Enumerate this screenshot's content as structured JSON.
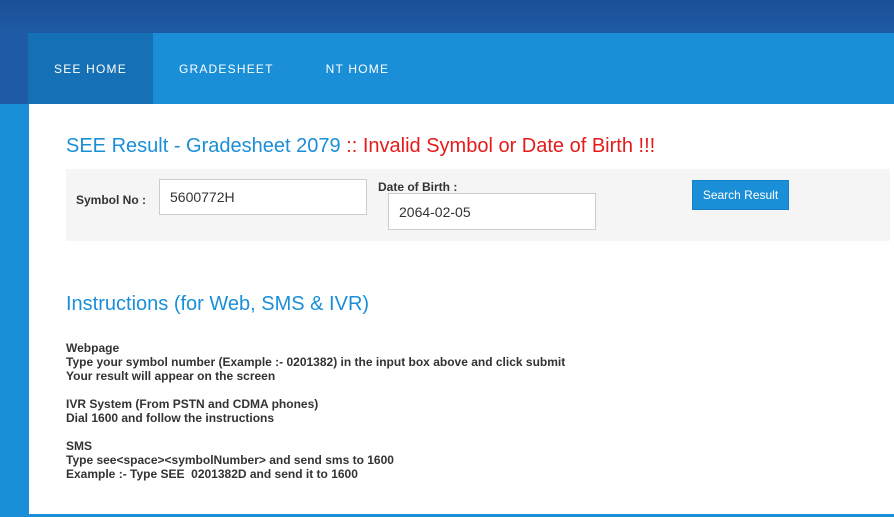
{
  "nav": {
    "items": [
      {
        "label": "SEE HOME"
      },
      {
        "label": "GRADESHEET"
      },
      {
        "label": "NT HOME"
      }
    ]
  },
  "title": {
    "main": "SEE Result - Gradesheet 2079",
    "error": " :: Invalid Symbol or Date of Birth !!!"
  },
  "form": {
    "symbol_label": "Symbol No :",
    "symbol_value": "5600772H",
    "dob_label": "Date of Birth :",
    "dob_value": "2064-02-05",
    "search_button": "Search Result"
  },
  "instructions": {
    "heading": "Instructions (for Web, SMS & IVR)",
    "webpage": {
      "title": "Webpage",
      "line1": "Type your symbol number (Example :- 0201382) in the input box above and click submit",
      "line2": "Your result will appear on the screen"
    },
    "ivr": {
      "title": "IVR System (From PSTN and CDMA phones)",
      "line1": "Dial 1600 and follow the instructions"
    },
    "sms": {
      "title": "SMS",
      "line1": "Type see<space><symbolNumber> and send sms to 1600",
      "line2": "Example :- Type SEE  0201382D and send it to 1600"
    }
  },
  "colors": {
    "accent": "#1a8fd8",
    "error": "#e41b1b",
    "header_dark": "#1f5aa6"
  }
}
